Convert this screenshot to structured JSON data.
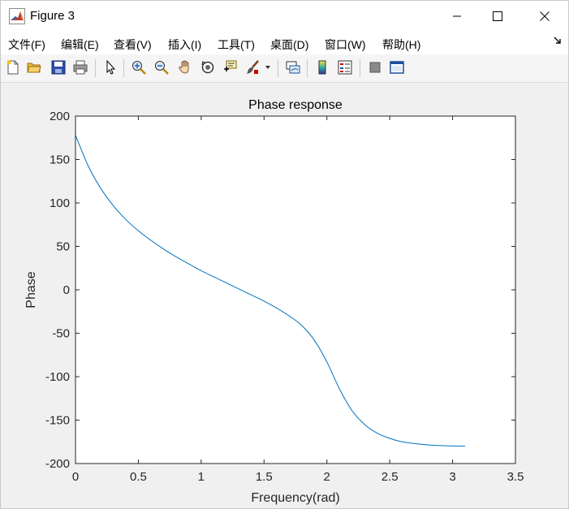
{
  "window": {
    "title": "Figure 3",
    "minimize_glyph": "—",
    "maximize_glyph": "☐",
    "close_glyph": "✕"
  },
  "menu": {
    "items": [
      "文件(F)",
      "编辑(E)",
      "查看(V)",
      "插入(I)",
      "工具(T)",
      "桌面(D)",
      "窗口(W)",
      "帮助(H)"
    ],
    "dock_glyph": "↘"
  },
  "toolbar": {
    "icons": [
      "new-figure-icon",
      "open-file-icon",
      "save-icon",
      "print-icon",
      "pointer-icon",
      "zoom-in-icon",
      "zoom-out-icon",
      "pan-hand-icon",
      "rotate-3d-icon",
      "data-cursor-icon",
      "brush-icon",
      "dropdown-arrow-icon",
      "link-plot-icon",
      "colorbar-icon",
      "legend-icon",
      "hide-plot-tools-icon",
      "show-plot-tools-icon"
    ]
  },
  "colors": {
    "line": "#0072bd",
    "axes_bg": "#ffffff",
    "figure_bg": "#f0f0f0",
    "axis_color": "#262626"
  },
  "chart_data": {
    "type": "line",
    "title": "Phase response",
    "xlabel": "Frequency(rad)",
    "ylabel": "Phase",
    "xlim": [
      0,
      3.5
    ],
    "ylim": [
      -200,
      200
    ],
    "xticks": [
      0,
      0.5,
      1,
      1.5,
      2,
      2.5,
      3,
      3.5
    ],
    "xtick_labels": [
      "0",
      "0.5",
      "1",
      "1.5",
      "2",
      "2.5",
      "3",
      "3.5"
    ],
    "yticks": [
      -200,
      -150,
      -100,
      -50,
      0,
      50,
      100,
      150,
      200
    ],
    "ytick_labels": [
      "-200",
      "-150",
      "-100",
      "-50",
      "0",
      "50",
      "100",
      "150",
      "200"
    ],
    "grid": false,
    "series": [
      {
        "x": [
          0,
          0.1,
          0.2,
          0.3,
          0.4,
          0.5,
          0.6,
          0.7,
          0.8,
          0.9,
          1.0,
          1.1,
          1.2,
          1.3,
          1.4,
          1.5,
          1.6,
          1.7,
          1.8,
          1.9,
          2.0,
          2.1,
          2.2,
          2.3,
          2.4,
          2.5,
          2.6,
          2.7,
          2.8,
          2.9,
          3.0,
          3.1
        ],
        "y": [
          178,
          143,
          117,
          97,
          81,
          68,
          57,
          47,
          38,
          30,
          22,
          15,
          8,
          1,
          -6,
          -13,
          -21,
          -30,
          -41,
          -58,
          -83,
          -114,
          -139,
          -155,
          -165,
          -171,
          -175,
          -177,
          -178.5,
          -179.3,
          -179.8,
          -180
        ]
      }
    ]
  }
}
